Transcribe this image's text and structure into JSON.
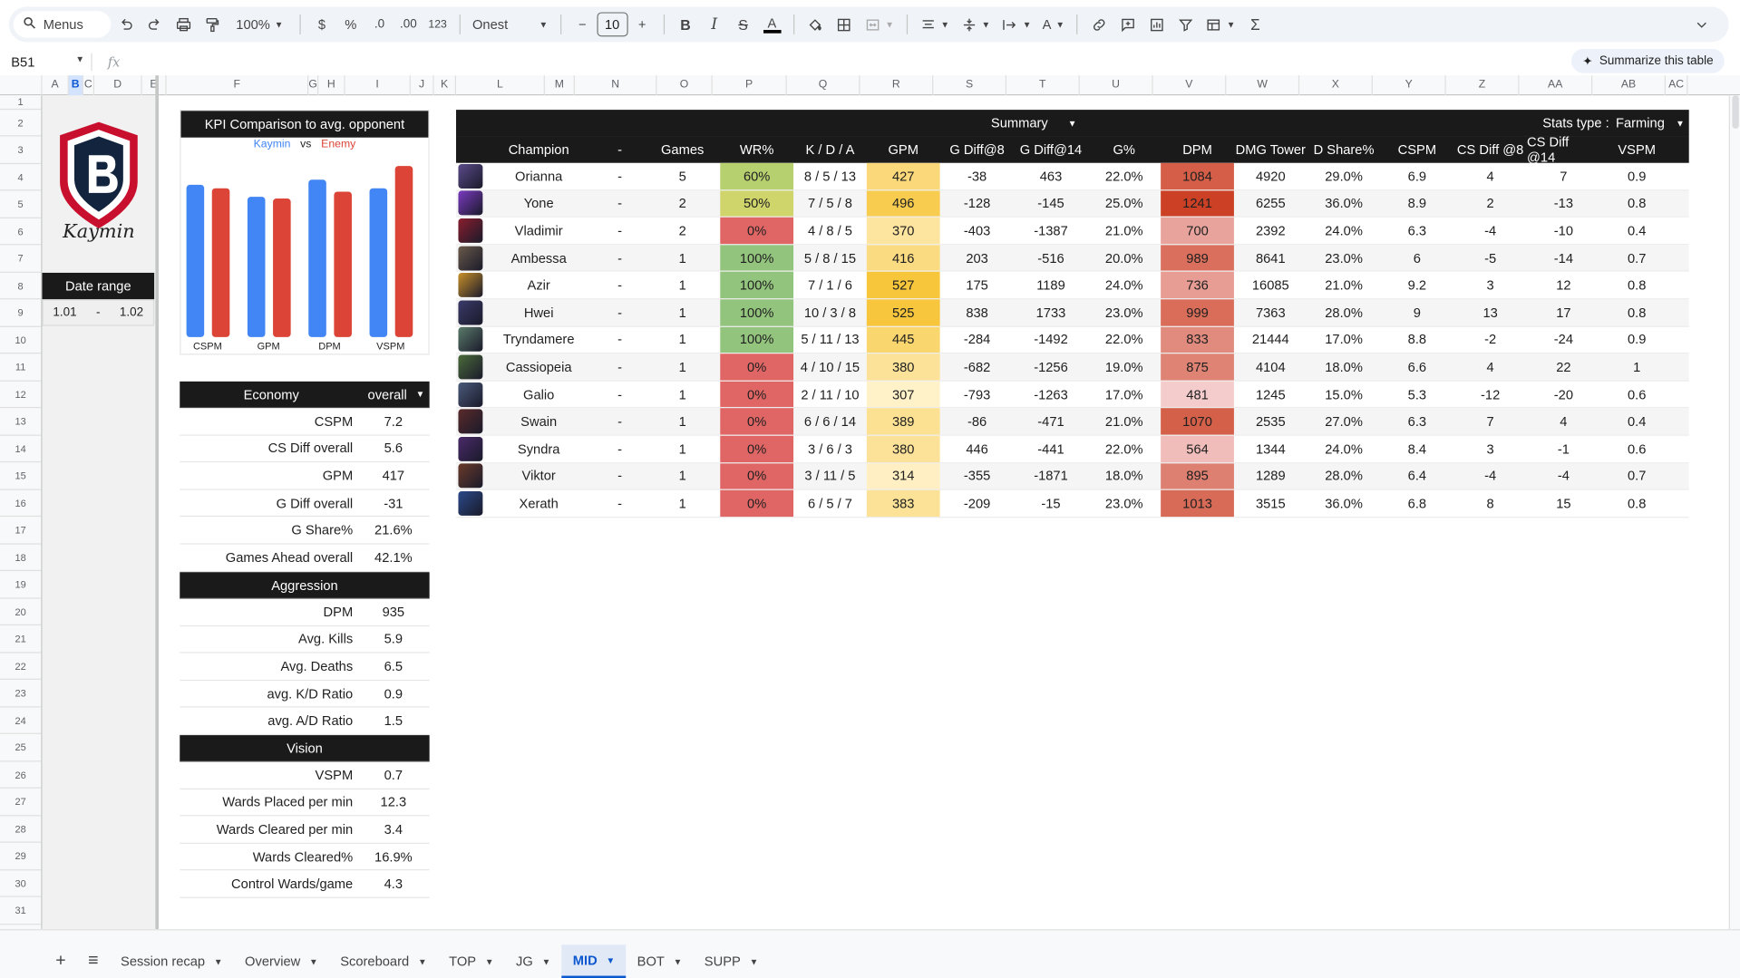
{
  "toolbar": {
    "menus_label": "Menus",
    "zoom": "100%",
    "currency": "$",
    "percent": "%",
    "dec_decrease": ".0",
    "dec_increase": ".00",
    "number_format": "123",
    "font_name": "Onest",
    "font_size": "10"
  },
  "formula_bar": {
    "cell_ref": "B51",
    "fx": "fx",
    "summarize_label": "Summarize this table"
  },
  "columns": [
    "A",
    "B",
    "C",
    "D",
    "E",
    "F",
    "G",
    "H",
    "I",
    "J",
    "K",
    "L",
    "M",
    "N",
    "O",
    "P",
    "Q",
    "R",
    "S",
    "T",
    "U",
    "V",
    "W",
    "X",
    "Y",
    "Z",
    "AA",
    "AB",
    "AC"
  ],
  "rows": [
    "1",
    "2",
    "3",
    "4",
    "5",
    "6",
    "7",
    "8",
    "9",
    "10",
    "11",
    "12",
    "13",
    "14",
    "15",
    "16",
    "17",
    "18",
    "19",
    "20",
    "21",
    "22",
    "23",
    "24",
    "25",
    "26",
    "27",
    "28",
    "29",
    "30",
    "31"
  ],
  "logo": {
    "letter": "B",
    "signature": "Kaymin"
  },
  "date_range": {
    "title": "Date range",
    "from": "1.01",
    "dash": "-",
    "to": "1.02"
  },
  "chart": {
    "title": "KPI Comparison to avg. opponent",
    "legend_player": "Kaymin",
    "legend_vs": "vs",
    "legend_enemy": "Enemy",
    "colors": {
      "player": "#4285f4",
      "enemy": "#db4437"
    }
  },
  "chart_data": {
    "type": "bar",
    "title": "KPI Comparison to avg. opponent",
    "categories": [
      "CSPM",
      "GPM",
      "DPM",
      "VSPM"
    ],
    "series": [
      {
        "name": "Kaymin",
        "values": [
          0.89,
          0.82,
          0.92,
          0.87
        ]
      },
      {
        "name": "Enemy",
        "values": [
          0.87,
          0.81,
          0.85,
          1.0
        ]
      }
    ],
    "ylim": [
      0,
      1.05
    ],
    "grid": false,
    "legend": "top-center"
  },
  "economy": {
    "title": "Economy",
    "filter": "overall",
    "rows": [
      {
        "label": "CSPM",
        "value": "7.2"
      },
      {
        "label": "CS Diff overall",
        "value": "5.6"
      },
      {
        "label": "GPM",
        "value": "417"
      },
      {
        "label": "G Diff overall",
        "value": "-31"
      },
      {
        "label": "G Share%",
        "value": "21.6%"
      },
      {
        "label": "Games Ahead overall",
        "value": "42.1%"
      }
    ]
  },
  "aggression": {
    "title": "Aggression",
    "rows": [
      {
        "label": "DPM",
        "value": "935"
      },
      {
        "label": "Avg. Kills",
        "value": "5.9"
      },
      {
        "label": "Avg. Deaths",
        "value": "6.5"
      },
      {
        "label": "avg. K/D Ratio",
        "value": "0.9"
      },
      {
        "label": "avg. A/D Ratio",
        "value": "1.5"
      }
    ]
  },
  "vision": {
    "title": "Vision",
    "rows": [
      {
        "label": "VSPM",
        "value": "0.7"
      },
      {
        "label": "Wards Placed per min",
        "value": "12.3"
      },
      {
        "label": "Wards Cleared per min",
        "value": "3.4"
      },
      {
        "label": "Wards Cleared%",
        "value": "16.9%"
      },
      {
        "label": "Control Wards/game",
        "value": "4.3"
      }
    ]
  },
  "summary_table": {
    "summary_label": "Summary",
    "stats_type_label": "Stats type :",
    "stats_type_value": "Farming",
    "headers": [
      "Champion",
      "-",
      "Games",
      "WR%",
      "K / D / A",
      "GPM",
      "G Diff@8",
      "G Diff@14",
      "G%",
      "DPM",
      "DMG Tower",
      "D Share%",
      "CSPM",
      "CS Diff @8",
      "CS Diff @14",
      "VSPM"
    ],
    "rows": [
      {
        "champ": "Orianna",
        "dash": "-",
        "games": "5",
        "wr": "60%",
        "kda": "8 / 5 / 13",
        "gpm": "427",
        "gd8": "-38",
        "gd14": "463",
        "gp": "22.0%",
        "dpm": "1084",
        "tower": "4920",
        "ds": "29.0%",
        "cspm": "6.9",
        "cs8": "4",
        "cs14": "7",
        "vspm": "0.9"
      },
      {
        "champ": "Yone",
        "dash": "-",
        "games": "2",
        "wr": "50%",
        "kda": "7 / 5 / 8",
        "gpm": "496",
        "gd8": "-128",
        "gd14": "-145",
        "gp": "25.0%",
        "dpm": "1241",
        "tower": "6255",
        "ds": "36.0%",
        "cspm": "8.9",
        "cs8": "2",
        "cs14": "-13",
        "vspm": "0.8"
      },
      {
        "champ": "Vladimir",
        "dash": "-",
        "games": "2",
        "wr": "0%",
        "kda": "4 / 8 / 5",
        "gpm": "370",
        "gd8": "-403",
        "gd14": "-1387",
        "gp": "21.0%",
        "dpm": "700",
        "tower": "2392",
        "ds": "24.0%",
        "cspm": "6.3",
        "cs8": "-4",
        "cs14": "-10",
        "vspm": "0.4"
      },
      {
        "champ": "Ambessa",
        "dash": "-",
        "games": "1",
        "wr": "100%",
        "kda": "5 / 8 / 15",
        "gpm": "416",
        "gd8": "203",
        "gd14": "-516",
        "gp": "20.0%",
        "dpm": "989",
        "tower": "8641",
        "ds": "23.0%",
        "cspm": "6",
        "cs8": "-5",
        "cs14": "-14",
        "vspm": "0.7"
      },
      {
        "champ": "Azir",
        "dash": "-",
        "games": "1",
        "wr": "100%",
        "kda": "7 / 1 / 6",
        "gpm": "527",
        "gd8": "175",
        "gd14": "1189",
        "gp": "24.0%",
        "dpm": "736",
        "tower": "16085",
        "ds": "21.0%",
        "cspm": "9.2",
        "cs8": "3",
        "cs14": "12",
        "vspm": "0.8"
      },
      {
        "champ": "Hwei",
        "dash": "-",
        "games": "1",
        "wr": "100%",
        "kda": "10 / 3 / 8",
        "gpm": "525",
        "gd8": "838",
        "gd14": "1733",
        "gp": "23.0%",
        "dpm": "999",
        "tower": "7363",
        "ds": "28.0%",
        "cspm": "9",
        "cs8": "13",
        "cs14": "17",
        "vspm": "0.8"
      },
      {
        "champ": "Tryndamere",
        "dash": "-",
        "games": "1",
        "wr": "100%",
        "kda": "5 / 11 / 13",
        "gpm": "445",
        "gd8": "-284",
        "gd14": "-1492",
        "gp": "22.0%",
        "dpm": "833",
        "tower": "21444",
        "ds": "17.0%",
        "cspm": "8.8",
        "cs8": "-2",
        "cs14": "-24",
        "vspm": "0.9"
      },
      {
        "champ": "Cassiopeia",
        "dash": "-",
        "games": "1",
        "wr": "0%",
        "kda": "4 / 10 / 15",
        "gpm": "380",
        "gd8": "-682",
        "gd14": "-1256",
        "gp": "19.0%",
        "dpm": "875",
        "tower": "4104",
        "ds": "18.0%",
        "cspm": "6.6",
        "cs8": "4",
        "cs14": "22",
        "vspm": "1"
      },
      {
        "champ": "Galio",
        "dash": "-",
        "games": "1",
        "wr": "0%",
        "kda": "2 / 11 / 10",
        "gpm": "307",
        "gd8": "-793",
        "gd14": "-1263",
        "gp": "17.0%",
        "dpm": "481",
        "tower": "1245",
        "ds": "15.0%",
        "cspm": "5.3",
        "cs8": "-12",
        "cs14": "-20",
        "vspm": "0.6"
      },
      {
        "champ": "Swain",
        "dash": "-",
        "games": "1",
        "wr": "0%",
        "kda": "6 / 6 / 14",
        "gpm": "389",
        "gd8": "-86",
        "gd14": "-471",
        "gp": "21.0%",
        "dpm": "1070",
        "tower": "2535",
        "ds": "27.0%",
        "cspm": "6.3",
        "cs8": "7",
        "cs14": "4",
        "vspm": "0.4"
      },
      {
        "champ": "Syndra",
        "dash": "-",
        "games": "1",
        "wr": "0%",
        "kda": "3 / 6 / 3",
        "gpm": "380",
        "gd8": "446",
        "gd14": "-441",
        "gp": "22.0%",
        "dpm": "564",
        "tower": "1344",
        "ds": "24.0%",
        "cspm": "8.4",
        "cs8": "3",
        "cs14": "-1",
        "vspm": "0.6"
      },
      {
        "champ": "Viktor",
        "dash": "-",
        "games": "1",
        "wr": "0%",
        "kda": "3 / 11 / 5",
        "gpm": "314",
        "gd8": "-355",
        "gd14": "-1871",
        "gp": "18.0%",
        "dpm": "895",
        "tower": "1289",
        "ds": "28.0%",
        "cspm": "6.4",
        "cs8": "-4",
        "cs14": "-4",
        "vspm": "0.7"
      },
      {
        "champ": "Xerath",
        "dash": "-",
        "games": "1",
        "wr": "0%",
        "kda": "6 / 5 / 7",
        "gpm": "383",
        "gd8": "-209",
        "gd14": "-15",
        "gp": "23.0%",
        "dpm": "1013",
        "tower": "3515",
        "ds": "36.0%",
        "cspm": "6.8",
        "cs8": "8",
        "cs14": "15",
        "vspm": "0.8"
      }
    ]
  },
  "sheet_tabs": [
    {
      "label": "Session recap",
      "active": false
    },
    {
      "label": "Overview",
      "active": false
    },
    {
      "label": "Scoreboard",
      "active": false
    },
    {
      "label": "TOP",
      "active": false
    },
    {
      "label": "JG",
      "active": false
    },
    {
      "label": "MID",
      "active": true
    },
    {
      "label": "BOT",
      "active": false
    },
    {
      "label": "SUPP",
      "active": false
    }
  ]
}
